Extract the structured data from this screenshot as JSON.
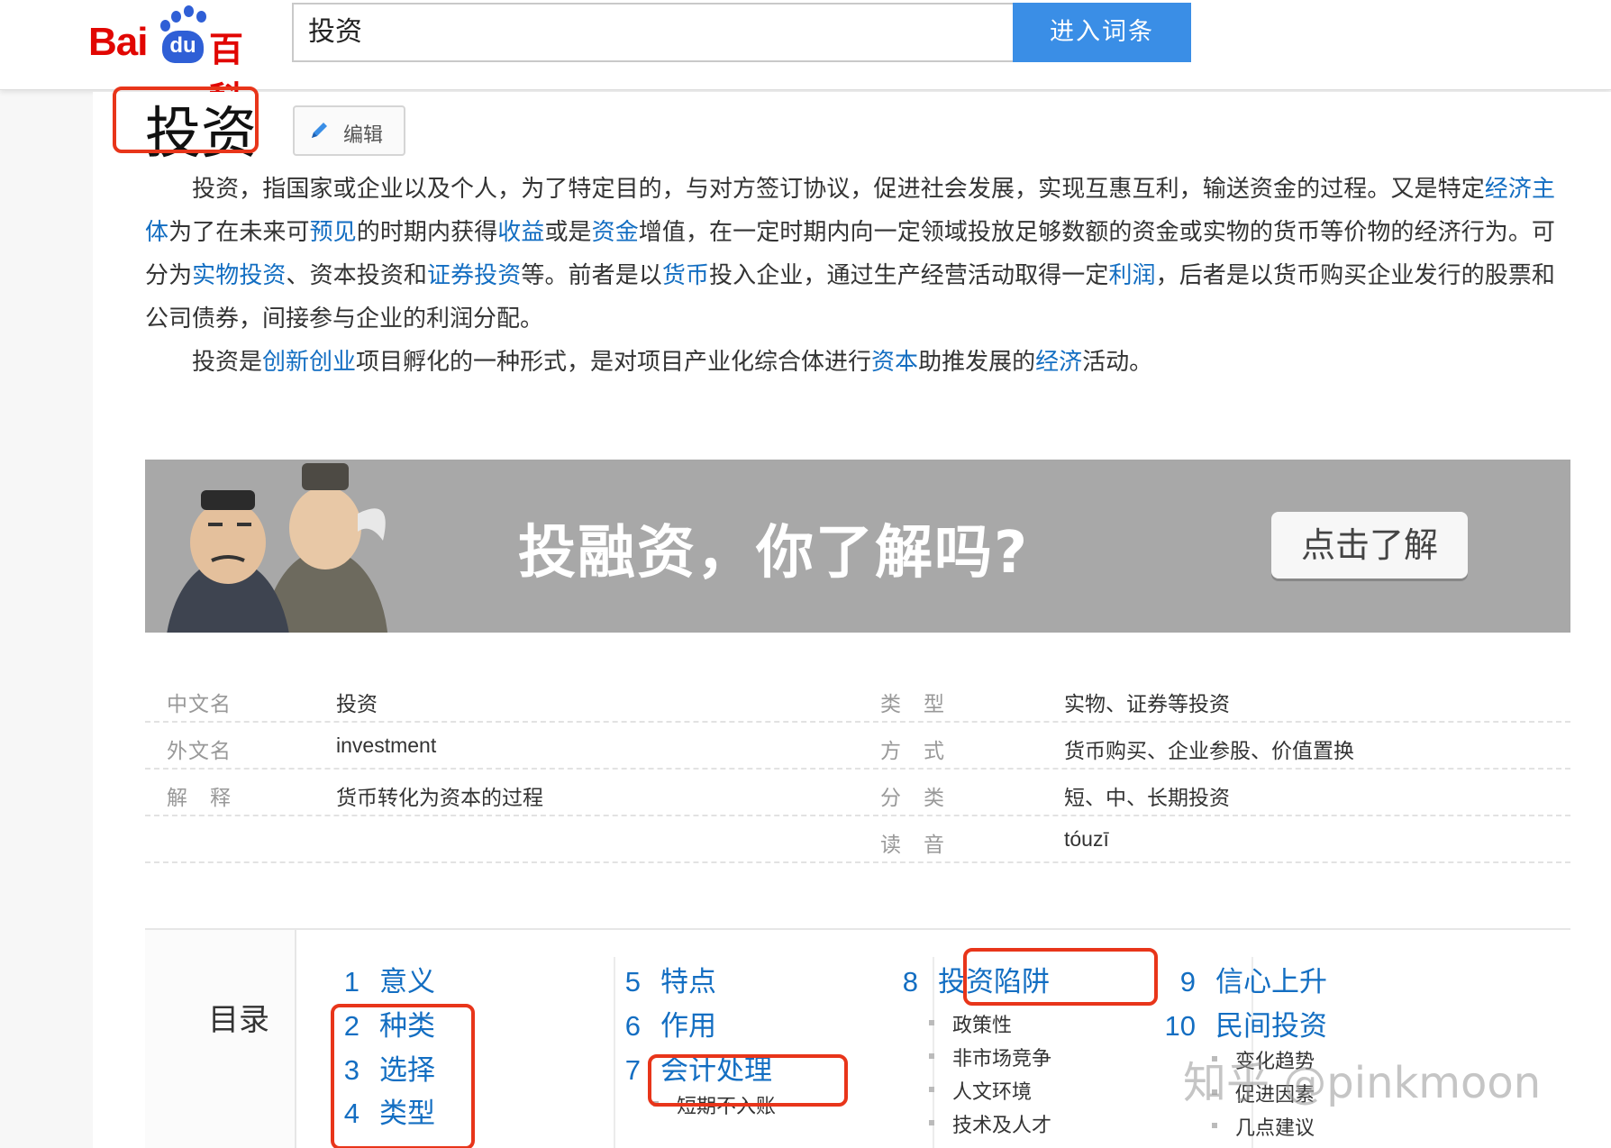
{
  "header": {
    "logo_bai": "Bai",
    "logo_du": "du",
    "logo_baike": "百科",
    "search_value": "投资",
    "search_button": "进入词条"
  },
  "entry": {
    "title": "投资",
    "edit_label": "编辑"
  },
  "intro": {
    "p1": [
      {
        "t": "投资，指国家或企业以及个人，为了特定目的，与对方签订协议，促进社会发展，实现互惠互利，输送资金的过程。又是特定"
      },
      {
        "t": "经济主体",
        "link": true
      },
      {
        "t": "为了在未来可"
      },
      {
        "t": "预见",
        "link": true
      },
      {
        "t": "的时期内获得"
      },
      {
        "t": "收益",
        "link": true
      },
      {
        "t": "或是"
      },
      {
        "t": "资金",
        "link": true
      },
      {
        "t": "增值，在一定时期内向一定领域投放足够数额的资金或实物的货币等价物的经济行为。可分为"
      },
      {
        "t": "实物投资",
        "link": true
      },
      {
        "t": "、资本投资和"
      },
      {
        "t": "证券投资",
        "link": true
      },
      {
        "t": "等。前者是以"
      },
      {
        "t": "货币",
        "link": true
      },
      {
        "t": "投入企业，通过生产经营活动取得一定"
      },
      {
        "t": "利润",
        "link": true
      },
      {
        "t": "，后者是以货币购买企业发行的股票和公司债券，间接参与企业的利润分配。"
      }
    ],
    "p2": [
      {
        "t": "投资是"
      },
      {
        "t": "创新创业",
        "link": true
      },
      {
        "t": "项目孵化的一种形式，是对项目产业化综合体进行"
      },
      {
        "t": "资本",
        "link": true
      },
      {
        "t": "助推发展的"
      },
      {
        "t": "经济",
        "link": true
      },
      {
        "t": "活动。"
      }
    ]
  },
  "banner": {
    "headline": "投融资，你了解吗?",
    "button": "点击了解"
  },
  "info": {
    "rows": [
      {
        "k1": "中文名",
        "v1": "投资",
        "k2": "类　型",
        "v2": "实物、证券等投资"
      },
      {
        "k1": "外文名",
        "v1": "investment",
        "k2": "方　式",
        "v2": "货币购买、企业参股、价值置换"
      },
      {
        "k1": "解　释",
        "v1": "货币转化为资本的过程",
        "k2": "分　类",
        "v2": "短、中、长期投资"
      },
      {
        "k1": "",
        "v1": "",
        "k2": "读　音",
        "v2": "tóuzī"
      }
    ]
  },
  "catalog": {
    "title": "目录",
    "items": [
      {
        "num": "1",
        "label": "意义"
      },
      {
        "num": "2",
        "label": "种类"
      },
      {
        "num": "3",
        "label": "选择"
      },
      {
        "num": "4",
        "label": "类型"
      },
      {
        "num": "5",
        "label": "特点"
      },
      {
        "num": "6",
        "label": "作用"
      },
      {
        "num": "7",
        "label": "会计处理"
      },
      {
        "num": "8",
        "label": "投资陷阱"
      },
      {
        "num": "9",
        "label": "信心上升"
      },
      {
        "num": "10",
        "label": "民间投资"
      }
    ],
    "subs": {
      "s7": [
        "短期不入账"
      ],
      "s8": [
        "政策性",
        "非市场竞争",
        "人文环境",
        "技术及人才"
      ],
      "s10": [
        "变化趋势",
        "促进因素",
        "几点建议"
      ]
    }
  },
  "watermark": "知乎 @pinkmoon",
  "colors": {
    "link": "#136ec2",
    "highlight": "#e8351a",
    "button": "#3a8ee6",
    "brand_red": "#e10602",
    "brand_blue": "#2f5fd6"
  }
}
